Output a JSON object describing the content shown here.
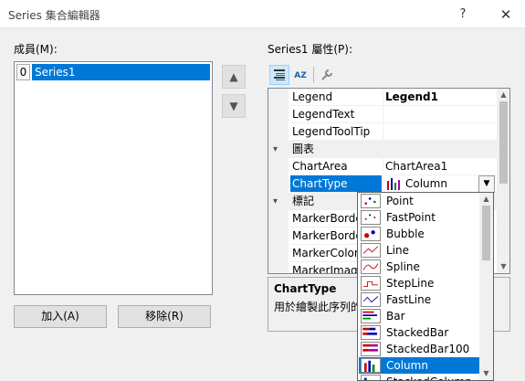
{
  "window": {
    "title": "Series 集合編輯器",
    "help": "?",
    "close": "✕"
  },
  "members": {
    "label": "成員(M):",
    "items": [
      {
        "index": "0",
        "name": "Series1"
      }
    ],
    "up_arrow": "▲",
    "down_arrow": "▼"
  },
  "buttons": {
    "add": "加入(A)",
    "remove": "移除(R)"
  },
  "properties": {
    "label": "Series1 屬性(P):",
    "toolbar": {
      "categorized": "categorized-icon",
      "alphabetical": "AZ",
      "pages": "wrench-icon"
    },
    "rows": [
      {
        "type": "prop",
        "name": "Legend",
        "value": "Legend1",
        "bold": true
      },
      {
        "type": "prop",
        "name": "LegendText",
        "value": ""
      },
      {
        "type": "prop",
        "name": "LegendToolTip",
        "value": ""
      },
      {
        "type": "cat",
        "name": "圖表"
      },
      {
        "type": "prop",
        "name": "ChartArea",
        "value": "ChartArea1"
      },
      {
        "type": "prop",
        "name": "ChartType",
        "value": "Column",
        "selected": true
      },
      {
        "type": "cat",
        "name": "標記"
      },
      {
        "type": "prop",
        "name": "MarkerBorde",
        "value": ""
      },
      {
        "type": "prop",
        "name": "MarkerBorde",
        "value": ""
      },
      {
        "type": "prop",
        "name": "MarkerColor",
        "value": ""
      },
      {
        "type": "prop",
        "name": "MarkerImage",
        "value": ""
      }
    ],
    "description": {
      "title": "ChartType",
      "text": "用於繪製此序列的"
    }
  },
  "chart_type_dropdown": {
    "items": [
      "Point",
      "FastPoint",
      "Bubble",
      "Line",
      "Spline",
      "StepLine",
      "FastLine",
      "Bar",
      "StackedBar",
      "StackedBar100",
      "Column",
      "StackedColumn"
    ],
    "selected": "Column"
  }
}
